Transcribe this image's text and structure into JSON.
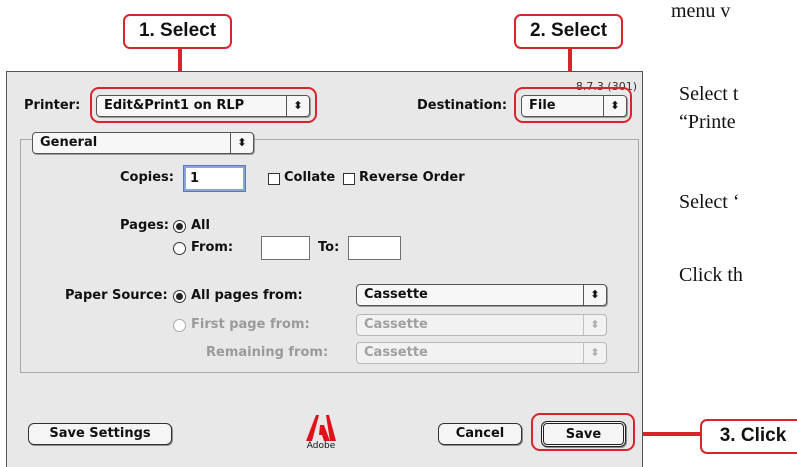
{
  "callouts": {
    "step1": "1. Select",
    "step2": "2. Select",
    "step3": "3. Click"
  },
  "side_text": {
    "line1": "menu v",
    "line2": "Select t",
    "line3": "“Printe",
    "line4": "Select ‘",
    "line5": "Click th"
  },
  "dialog": {
    "version": "8.7.3 (301)",
    "printer_label": "Printer:",
    "printer_value": "Edit&Print1 on RLP",
    "destination_label": "Destination:",
    "destination_value": "File",
    "panel_value": "General",
    "copies_label": "Copies:",
    "copies_value": "1",
    "collate_label": "Collate",
    "reverse_label": "Reverse Order",
    "pages_label": "Pages:",
    "pages_all_label": "All",
    "pages_from_label": "From:",
    "pages_from_value": "",
    "pages_to_label": "To:",
    "pages_to_value": "",
    "paper_source_label": "Paper Source:",
    "all_pages_from_label": "All pages from:",
    "all_pages_from_value": "Cassette",
    "first_page_from_label": "First page from:",
    "first_page_from_value": "Cassette",
    "remaining_from_label": "Remaining from:",
    "remaining_from_value": "Cassette",
    "save_settings_button": "Save Settings",
    "adobe_logo_text": "Adobe",
    "cancel_button": "Cancel",
    "save_button": "Save"
  },
  "icons": {
    "popup_arrow": "updown-arrow-icon",
    "logo": "adobe-logo-icon"
  },
  "colors": {
    "callout_red": "#d6252b",
    "dialog_bg": "#e8e8e8",
    "focus_blue": "#8aa4d8"
  }
}
